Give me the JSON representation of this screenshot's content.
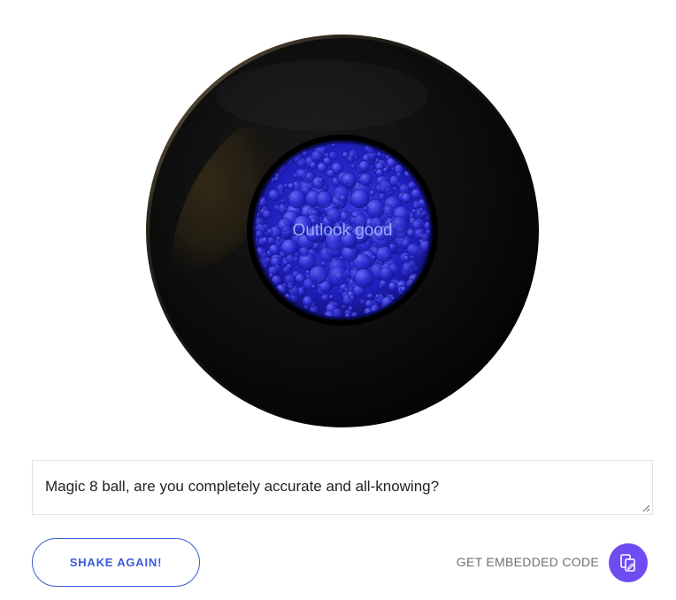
{
  "ball": {
    "answer": "Outlook good"
  },
  "question": {
    "value": "Magic 8 ball, are you completely accurate and all-knowing?"
  },
  "actions": {
    "shake_label": "SHAKE AGAIN!",
    "embed_label": "GET EMBEDDED CODE",
    "embed_icon": "copy-code-icon"
  },
  "colors": {
    "accent": "#3b5bdb",
    "embed_button": "#6f4cf2",
    "answer_text": "#93b0f2",
    "ball": "#0a0a0a",
    "window": "#2323c8"
  }
}
